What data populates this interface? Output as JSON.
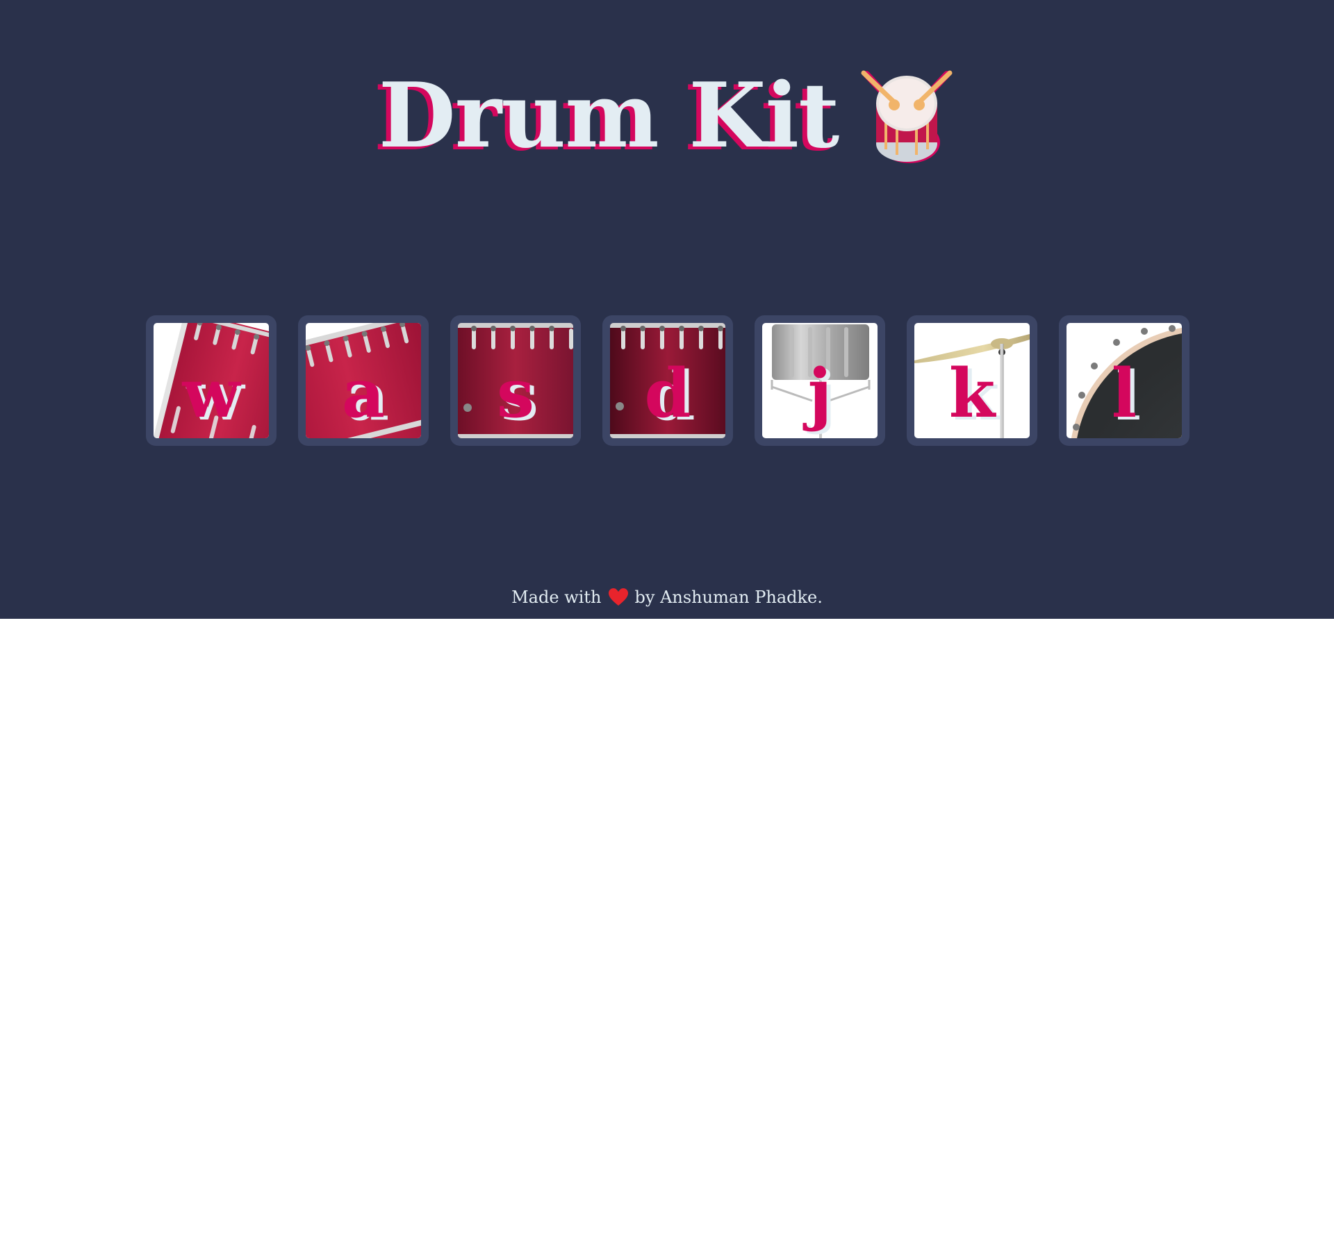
{
  "header": {
    "title": "Drum Kit",
    "icon": "drum-icon"
  },
  "keys": [
    {
      "letter": "w",
      "icon": "tom-drum-tilted-icon"
    },
    {
      "letter": "a",
      "icon": "tom-drum-tilted-icon"
    },
    {
      "letter": "s",
      "icon": "floor-tom-icon"
    },
    {
      "letter": "d",
      "icon": "floor-tom-icon"
    },
    {
      "letter": "j",
      "icon": "snare-drum-icon"
    },
    {
      "letter": "k",
      "icon": "cymbal-icon"
    },
    {
      "letter": "l",
      "icon": "bass-drum-icon"
    }
  ],
  "footer": {
    "made_with": "Made with",
    "heart_icon": "heart-icon",
    "by_text": "by Anshuman Phadke."
  },
  "colors": {
    "background": "#2a314b",
    "key_frame": "#3c4565",
    "accent": "#d4075d",
    "text": "#e3edf3",
    "heart": "#e8242c"
  }
}
